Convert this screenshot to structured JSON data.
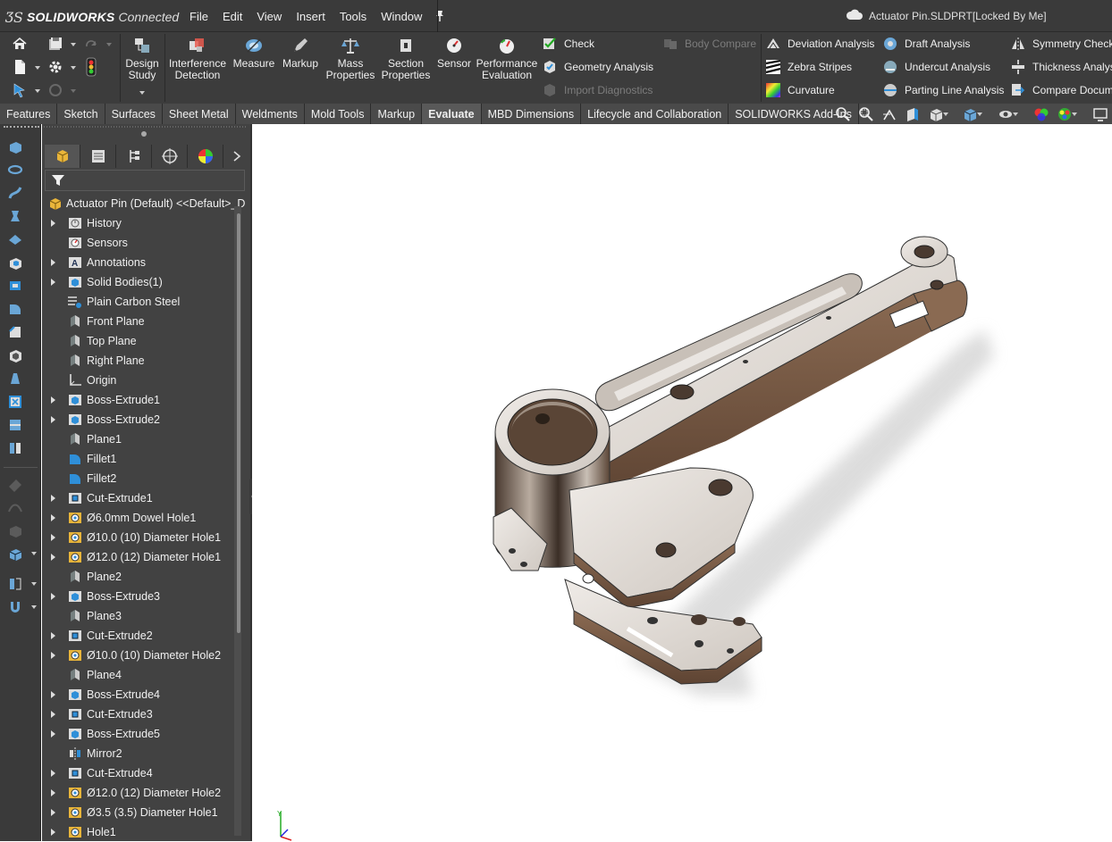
{
  "app": {
    "brand": "SOLIDWORKS",
    "brand_suffix": "Connected",
    "document_title": "Actuator Pin.SLDPRT[Locked By Me]"
  },
  "menu": [
    "File",
    "Edit",
    "View",
    "Insert",
    "Tools",
    "Window"
  ],
  "toolbar": {
    "design_study": [
      "Design",
      "Study"
    ],
    "tools": [
      {
        "l1": "Interference",
        "l2": "Detection",
        "icon": "interference-icon"
      },
      {
        "l1": "Measure",
        "l2": "",
        "icon": "measure-icon"
      },
      {
        "l1": "Markup",
        "l2": "",
        "icon": "markup-icon"
      },
      {
        "l1": "Mass",
        "l2": "Properties",
        "icon": "mass-properties-icon"
      },
      {
        "l1": "Section",
        "l2": "Properties",
        "icon": "section-properties-icon"
      },
      {
        "l1": "Sensor",
        "l2": "",
        "icon": "sensor-icon"
      },
      {
        "l1": "Performance",
        "l2": "Evaluation",
        "icon": "performance-icon"
      }
    ],
    "check": "Check",
    "geometry_analysis": "Geometry Analysis",
    "import_diagnostics": "Import Diagnostics",
    "body_compare": "Body Compare",
    "deviation_analysis": "Deviation Analysis",
    "zebra_stripes": "Zebra Stripes",
    "curvature": "Curvature",
    "draft_analysis": "Draft Analysis",
    "undercut_analysis": "Undercut Analysis",
    "parting_line_analysis": "Parting Line Analysis",
    "symmetry_check": "Symmetry Check",
    "thickness_analysis": "Thickness Analysis",
    "compare_documents": "Compare Documents"
  },
  "tabs": [
    {
      "label": "Features",
      "active": false
    },
    {
      "label": "Sketch",
      "active": false
    },
    {
      "label": "Surfaces",
      "active": false
    },
    {
      "label": "Sheet Metal",
      "active": false
    },
    {
      "label": "Weldments",
      "active": false
    },
    {
      "label": "Mold Tools",
      "active": false
    },
    {
      "label": "Markup",
      "active": false
    },
    {
      "label": "Evaluate",
      "active": true
    },
    {
      "label": "MBD Dimensions",
      "active": false
    },
    {
      "label": "Lifecycle and Collaboration",
      "active": false
    },
    {
      "label": "SOLIDWORKS Add-Ins",
      "active": false
    }
  ],
  "feature_tree": {
    "root": "Actuator Pin (Default) <<Default>_D",
    "items": [
      {
        "label": "History",
        "expandable": true,
        "icon": "history-icon"
      },
      {
        "label": "Sensors",
        "expandable": false,
        "icon": "sensor-icon"
      },
      {
        "label": "Annotations",
        "expandable": true,
        "icon": "annotations-icon"
      },
      {
        "label": "Solid Bodies(1)",
        "expandable": true,
        "icon": "solid-bodies-icon"
      },
      {
        "label": "Plain Carbon Steel",
        "expandable": false,
        "icon": "material-icon"
      },
      {
        "label": "Front Plane",
        "expandable": false,
        "icon": "plane-icon"
      },
      {
        "label": "Top Plane",
        "expandable": false,
        "icon": "plane-icon"
      },
      {
        "label": "Right Plane",
        "expandable": false,
        "icon": "plane-icon"
      },
      {
        "label": "Origin",
        "expandable": false,
        "icon": "origin-icon"
      },
      {
        "label": "Boss-Extrude1",
        "expandable": true,
        "icon": "boss-extrude-icon"
      },
      {
        "label": "Boss-Extrude2",
        "expandable": true,
        "icon": "boss-extrude-icon"
      },
      {
        "label": "Plane1",
        "expandable": false,
        "icon": "plane-icon"
      },
      {
        "label": "Fillet1",
        "expandable": false,
        "icon": "fillet-icon"
      },
      {
        "label": "Fillet2",
        "expandable": false,
        "icon": "fillet-icon"
      },
      {
        "label": "Cut-Extrude1",
        "expandable": true,
        "icon": "cut-extrude-icon"
      },
      {
        "label": "Ø6.0mm Dowel Hole1",
        "expandable": true,
        "icon": "hole-wizard-icon"
      },
      {
        "label": "Ø10.0 (10) Diameter Hole1",
        "expandable": true,
        "icon": "hole-wizard-icon"
      },
      {
        "label": "Ø12.0 (12) Diameter Hole1",
        "expandable": true,
        "icon": "hole-wizard-icon"
      },
      {
        "label": "Plane2",
        "expandable": false,
        "icon": "plane-icon"
      },
      {
        "label": "Boss-Extrude3",
        "expandable": true,
        "icon": "boss-extrude-icon"
      },
      {
        "label": "Plane3",
        "expandable": false,
        "icon": "plane-icon"
      },
      {
        "label": "Cut-Extrude2",
        "expandable": true,
        "icon": "cut-extrude-icon"
      },
      {
        "label": "Ø10.0 (10) Diameter Hole2",
        "expandable": true,
        "icon": "hole-wizard-icon"
      },
      {
        "label": "Plane4",
        "expandable": false,
        "icon": "plane-icon"
      },
      {
        "label": "Boss-Extrude4",
        "expandable": true,
        "icon": "boss-extrude-icon"
      },
      {
        "label": "Cut-Extrude3",
        "expandable": true,
        "icon": "cut-extrude-icon"
      },
      {
        "label": "Boss-Extrude5",
        "expandable": true,
        "icon": "boss-extrude-icon"
      },
      {
        "label": "Mirror2",
        "expandable": false,
        "icon": "mirror-icon"
      },
      {
        "label": "Cut-Extrude4",
        "expandable": true,
        "icon": "cut-extrude-icon"
      },
      {
        "label": "Ø12.0 (12) Diameter Hole2",
        "expandable": true,
        "icon": "hole-wizard-icon"
      },
      {
        "label": "Ø3.5 (3.5) Diameter Hole1",
        "expandable": true,
        "icon": "hole-wizard-icon"
      },
      {
        "label": "Hole1",
        "expandable": true,
        "icon": "hole-wizard-icon"
      }
    ]
  },
  "colors": {
    "ui_dark": "#3c3c3c",
    "panel": "#424242",
    "accent_blue": "#2f8fd8",
    "part_light": "#d9d4ce",
    "part_dark": "#7a5c45"
  }
}
